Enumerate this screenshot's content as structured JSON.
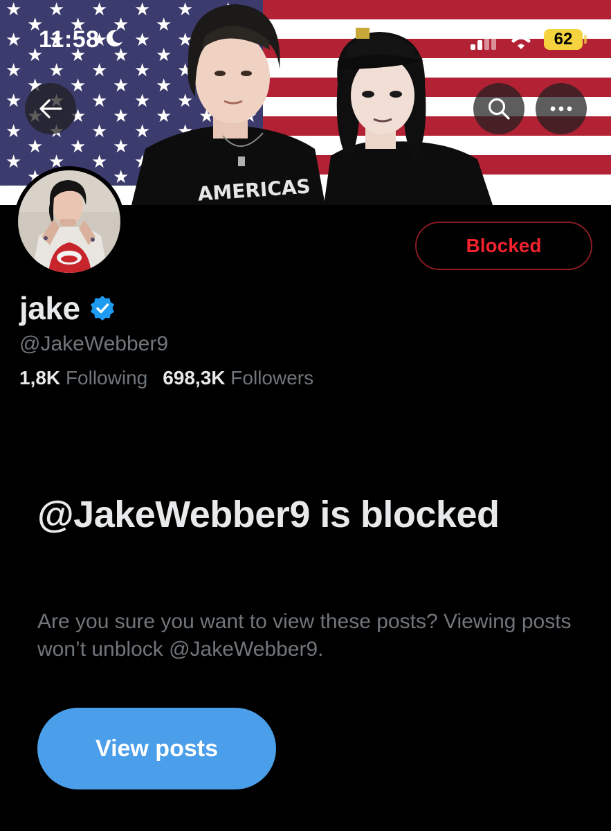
{
  "status_bar": {
    "time": "11:58",
    "battery": "62",
    "icons": [
      "moon-icon",
      "signal-icon",
      "wifi-icon",
      "battery-icon"
    ]
  },
  "nav": {
    "back_icon": "arrow-left-icon",
    "search_icon": "search-icon",
    "more_icon": "more-horizontal-icon"
  },
  "banner": {
    "printed_text": "AMERICAS"
  },
  "profile": {
    "display_name": "jake",
    "verified": true,
    "handle": "@JakeWebber9",
    "following_count": "1,8K",
    "following_label": "Following",
    "followers_count": "698,3K",
    "followers_label": "Followers",
    "blocked_button_label": "Blocked"
  },
  "blocked_notice": {
    "title": "@JakeWebber9 is blocked",
    "description": "Are you sure you want to view these posts? Viewing posts won’t unblock @JakeWebber9.",
    "view_posts_label": "View posts"
  },
  "colors": {
    "background": "#000000",
    "primary_text": "#e7e9ea",
    "secondary_text": "#71767b",
    "blocked_red": "#f4212e",
    "blocked_border": "#8a1c22",
    "accent_blue": "#4a9eea",
    "verified_blue": "#1d9bf0",
    "battery_yellow": "#f5d33e"
  }
}
